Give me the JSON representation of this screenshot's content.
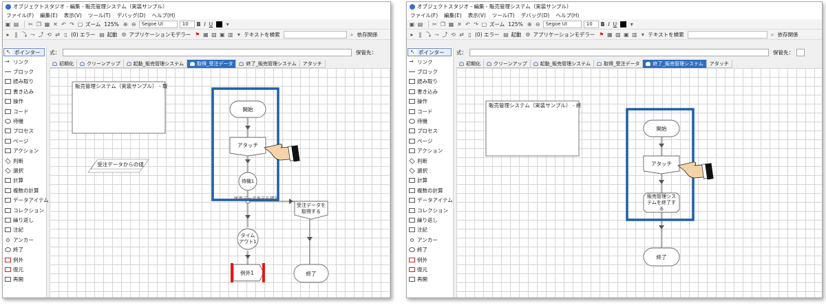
{
  "left": {
    "title": "オブジェクトスタジオ - 編集 - 販売管理システム（実装サンプル）",
    "menu": [
      "ファイル(F)",
      "編集(E)",
      "表示(V)",
      "ツール(T)",
      "デバッグ(D)",
      "ヘルプ(H)"
    ],
    "zoom_label": "ズーム",
    "zoom": "125%",
    "font": "Segoe UI",
    "font_size": "10",
    "bold": "B",
    "italic": "I",
    "underline": "U",
    "errors": "(0) エラー",
    "launch": "起動",
    "app_modeler": "アプリケーションモデラー",
    "search_text": "テキストを検索",
    "dependency": "依存関係",
    "formula_label": "式：",
    "dest_label": "保管先：",
    "tabs": [
      "初期化",
      "クリーンアップ",
      "起動_販売管理システム",
      "取得_受注データ",
      "終了_販売管理システム",
      "アタッチ"
    ],
    "active_tab": 3,
    "palette": [
      "ポインター",
      "リンク",
      "ブロック",
      "読み取り",
      "書き込み",
      "操作",
      "コード",
      "待機",
      "プロセス",
      "ページ",
      "アクション",
      "判断",
      "選択",
      "計算",
      "複数の計算",
      "データアイテム",
      "コレクション",
      "繰り返し",
      "注記",
      "アンカー",
      "終了",
      "例外",
      "復元",
      "再開"
    ],
    "flow": {
      "block": "販売管理システム（実装サンプル） - 取",
      "start": "開始",
      "attach": "アタッチ",
      "wait": "待機1",
      "timeout": "タイムアウト1",
      "exception": "例外1",
      "end": "終了",
      "notice": "受注データからの値",
      "get": "受注データを取得する",
      "branch_label": "販売データ表示を確認"
    }
  },
  "right": {
    "title": "オブジェクトスタジオ - 編集 - 販売管理システム（実装サンプル）",
    "menu": [
      "ファイル(F)",
      "編集(E)",
      "表示(V)",
      "ツール(T)",
      "デバッグ(D)",
      "ヘルプ(H)"
    ],
    "zoom_label": "ズーム",
    "zoom": "125%",
    "font": "Segoe UI",
    "font_size": "10",
    "bold": "B",
    "italic": "I",
    "underline": "U",
    "errors": "(0) エラー",
    "launch": "起動",
    "app_modeler": "アプリケーションモデラー",
    "search_text": "テキストを検索",
    "dependency": "依存関係",
    "formula_label": "式：",
    "dest_label": "保管先：",
    "tabs": [
      "初期化",
      "クリーンアップ",
      "起動_販売管理システム",
      "取得_受注データ",
      "終了_販売管理システム",
      "アタッチ"
    ],
    "active_tab": 4,
    "palette": [
      "ポインター",
      "リンク",
      "ブロック",
      "読み取り",
      "書き込み",
      "操作",
      "コード",
      "待機",
      "プロセス",
      "ページ",
      "アクション",
      "判断",
      "選択",
      "計算",
      "複数の計算",
      "データアイテム",
      "コレクション",
      "繰り返し",
      "注記",
      "アンカー",
      "終了",
      "例外",
      "復元",
      "再開"
    ],
    "flow": {
      "block": "販売管理システム（実装サンプル） - 終",
      "start": "開始",
      "attach": "アタッチ",
      "close": "販売管理システムを終了する",
      "end": "終了"
    }
  },
  "colors": {
    "highlight": "#1e5fa8",
    "active_tab": "#2c6fc2",
    "exception_bar": "#e01b1b"
  }
}
